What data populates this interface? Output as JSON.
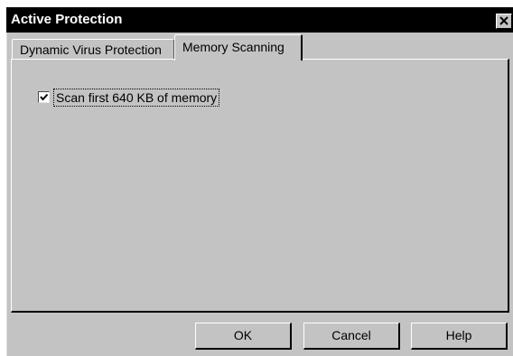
{
  "window": {
    "title": "Active Protection",
    "close_icon": "close-icon"
  },
  "tabs": [
    {
      "label": "Dynamic Virus Protection",
      "active": false
    },
    {
      "label": "Memory Scanning",
      "active": true
    }
  ],
  "memory_scanning": {
    "scan_memory_checkbox": {
      "label": "Scan first 640 KB of memory",
      "checked": true
    }
  },
  "buttons": {
    "ok_label": "OK",
    "cancel_label": "Cancel",
    "help_label": "Help"
  },
  "colors": {
    "titlebar": "#000000",
    "dialog_face": "#c3c3c3"
  }
}
